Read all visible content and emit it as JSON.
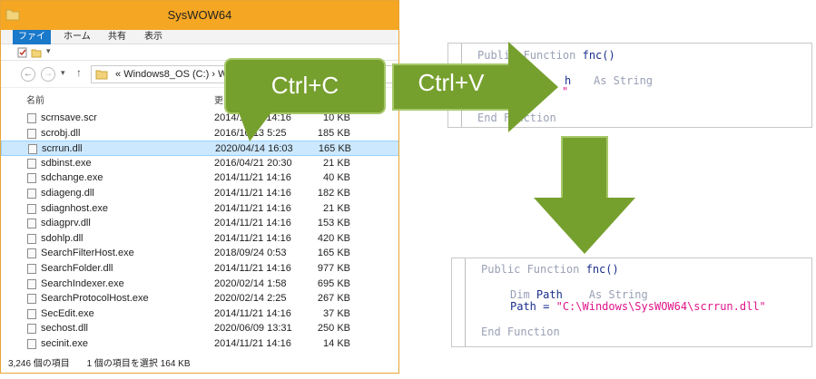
{
  "window": {
    "title": "SysWOW64",
    "ribbon_tabs": [
      "ファイル",
      "ホーム",
      "共有",
      "表示"
    ],
    "address": {
      "prefix": "«",
      "path": "Windows8_OS (C:)",
      "sep": "›",
      "tail": "W"
    },
    "columns": {
      "name": "名前",
      "date": "更"
    },
    "files": [
      {
        "name": "scrnsave.scr",
        "date": "2014/11/21 14:16",
        "size": "10 KB"
      },
      {
        "name": "scrobj.dll",
        "date": "2016/10/13 5:25",
        "size": "185 KB"
      },
      {
        "name": "scrrun.dll",
        "date": "2020/04/14 16:03",
        "size": "165 KB",
        "selected": true
      },
      {
        "name": "sdbinst.exe",
        "date": "2016/04/21 20:30",
        "size": "21 KB"
      },
      {
        "name": "sdchange.exe",
        "date": "2014/11/21 14:16",
        "size": "40 KB"
      },
      {
        "name": "sdiageng.dll",
        "date": "2014/11/21 14:16",
        "size": "182 KB"
      },
      {
        "name": "sdiagnhost.exe",
        "date": "2014/11/21 14:16",
        "size": "21 KB"
      },
      {
        "name": "sdiagprv.dll",
        "date": "2014/11/21 14:16",
        "size": "153 KB"
      },
      {
        "name": "sdohlp.dll",
        "date": "2014/11/21 14:16",
        "size": "420 KB"
      },
      {
        "name": "SearchFilterHost.exe",
        "date": "2018/09/24 0:53",
        "size": "165 KB"
      },
      {
        "name": "SearchFolder.dll",
        "date": "2014/11/21 14:16",
        "size": "977 KB"
      },
      {
        "name": "SearchIndexer.exe",
        "date": "2020/02/14 1:58",
        "size": "695 KB"
      },
      {
        "name": "SearchProtocolHost.exe",
        "date": "2020/02/14 2:25",
        "size": "267 KB"
      },
      {
        "name": "SecEdit.exe",
        "date": "2014/11/21 14:16",
        "size": "37 KB"
      },
      {
        "name": "sechost.dll",
        "date": "2020/06/09 13:31",
        "size": "250 KB"
      },
      {
        "name": "secinit.exe",
        "date": "2014/11/21 14:16",
        "size": "14 KB"
      }
    ],
    "status": {
      "count": "3,246 個の項目",
      "selection": "1 個の項目を選択  164 KB"
    }
  },
  "callouts": {
    "copy": "Ctrl+C",
    "paste": "Ctrl+V"
  },
  "code_before": {
    "l1_kw": "Public Function",
    "l1_fn": "fnc()",
    "l2_id": "h",
    "l2_kw": "As String",
    "l3_str": "\"",
    "l4_kw": "End Function"
  },
  "code_after": {
    "l1_kw": "Public Function",
    "l1_fn": "fnc()",
    "l2_kw1": "Dim",
    "l2_id": "Path",
    "l2_kw2": "As String",
    "l3_id": "Path",
    "l3_eq": " = ",
    "l3_str": "\"C:\\Windows\\SysWOW64\\scrrun.dll\"",
    "l4_kw": "End Function"
  },
  "colors": {
    "accent_green": "#76a02e",
    "title_orange": "#f5a623",
    "selection": "#cce8ff"
  }
}
